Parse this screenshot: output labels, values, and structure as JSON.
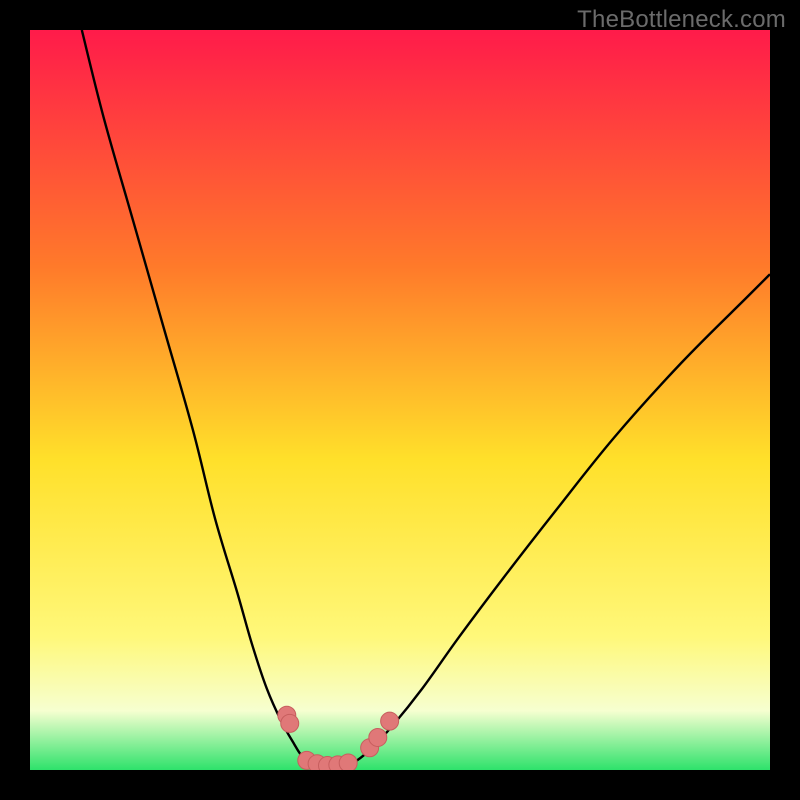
{
  "watermark": "TheBottleneck.com",
  "colors": {
    "frame": "#000000",
    "gradient_top": "#ff1b4a",
    "gradient_mid_orange": "#ff7a2a",
    "gradient_mid_yellow": "#ffe02a",
    "gradient_lower_yellow": "#fff87a",
    "gradient_pale": "#f6ffd0",
    "gradient_green": "#2ee26b",
    "curve": "#000000",
    "marker_fill": "#e07878",
    "marker_stroke": "#c75e5e"
  },
  "chart_data": {
    "type": "line",
    "title": "",
    "xlabel": "",
    "ylabel": "",
    "xlim": [
      0,
      100
    ],
    "ylim": [
      0,
      100
    ],
    "grid": false,
    "legend": false,
    "series": [
      {
        "name": "left-branch",
        "x": [
          7,
          10,
          14,
          18,
          22,
          25,
          28,
          30,
          32,
          34,
          35.7,
          36.5,
          37.3
        ],
        "y": [
          100,
          88,
          74,
          60,
          46,
          34,
          24,
          17,
          11,
          6.5,
          3.5,
          2.2,
          1.3
        ]
      },
      {
        "name": "valley-floor",
        "x": [
          37.3,
          38.5,
          40,
          41.5,
          43,
          44.2
        ],
        "y": [
          1.3,
          0.8,
          0.6,
          0.6,
          0.8,
          1.3
        ]
      },
      {
        "name": "right-branch",
        "x": [
          44.2,
          46,
          49,
          53,
          58,
          64,
          71,
          79,
          88,
          97,
          100
        ],
        "y": [
          1.3,
          2.8,
          6,
          11,
          18,
          26,
          35,
          45,
          55,
          64,
          67
        ]
      }
    ],
    "markers": [
      {
        "x": 34.7,
        "y": 7.4
      },
      {
        "x": 35.1,
        "y": 6.3
      },
      {
        "x": 37.4,
        "y": 1.3
      },
      {
        "x": 38.8,
        "y": 0.85
      },
      {
        "x": 40.2,
        "y": 0.6
      },
      {
        "x": 41.6,
        "y": 0.7
      },
      {
        "x": 43.0,
        "y": 0.95
      },
      {
        "x": 45.9,
        "y": 3.0
      },
      {
        "x": 47.0,
        "y": 4.4
      },
      {
        "x": 48.6,
        "y": 6.6
      }
    ]
  }
}
